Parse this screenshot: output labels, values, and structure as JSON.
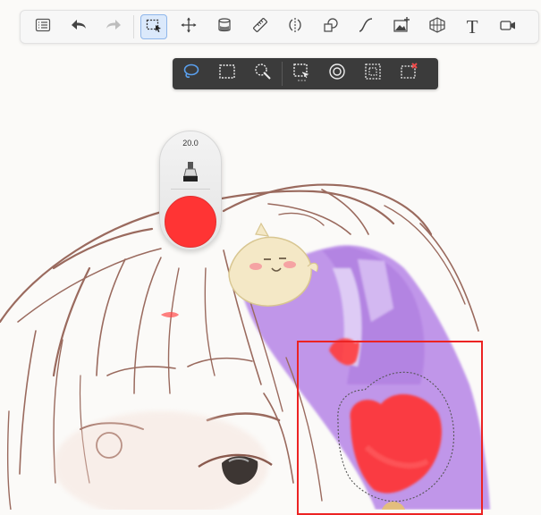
{
  "toolbar": {
    "tools": [
      {
        "name": "layers-list-button",
        "icon": "list-icon",
        "active": false
      },
      {
        "name": "undo-button",
        "icon": "undo-icon",
        "active": false
      },
      {
        "name": "redo-button",
        "icon": "redo-icon",
        "active": false
      },
      {
        "name": "selection-tool-button",
        "icon": "selection-icon",
        "active": true
      },
      {
        "name": "move-tool-button",
        "icon": "move-icon",
        "active": false
      },
      {
        "name": "fill-tool-button",
        "icon": "paint-bucket-icon",
        "active": false
      },
      {
        "name": "ruler-tool-button",
        "icon": "ruler-icon",
        "active": false
      },
      {
        "name": "symmetry-tool-button",
        "icon": "symmetry-icon",
        "active": false
      },
      {
        "name": "shape-tool-button",
        "icon": "shapes-icon",
        "active": false
      },
      {
        "name": "curve-tool-button",
        "icon": "curve-icon",
        "active": false
      },
      {
        "name": "image-insert-button",
        "icon": "image-plus-icon",
        "active": false
      },
      {
        "name": "perspective-grid-button",
        "icon": "perspective-grid-icon",
        "active": false
      },
      {
        "name": "text-tool-button",
        "icon": "text-icon",
        "active": false
      },
      {
        "name": "video-record-button",
        "icon": "video-camera-icon",
        "active": false
      }
    ],
    "text_tool_label": "T"
  },
  "selection_toolbar": {
    "tools": [
      {
        "name": "lasso-select-button",
        "icon": "lasso-icon",
        "active": true
      },
      {
        "name": "rectangle-select-button",
        "icon": "rect-marquee-icon"
      },
      {
        "name": "magic-wand-button",
        "icon": "magic-wand-icon"
      },
      {
        "name": "selection-options-button",
        "icon": "selection-options-icon"
      },
      {
        "name": "circle-select-button",
        "icon": "circle-target-icon"
      },
      {
        "name": "transform-selection-button",
        "icon": "transform-select-icon"
      },
      {
        "name": "clear-selection-button",
        "icon": "deselect-icon"
      }
    ]
  },
  "brush": {
    "size": "20.0",
    "color": "#ff3434",
    "tool_icon": "brush-nib-icon"
  },
  "colors": {
    "accent": "#2f7ad9",
    "selection_box": "#ec2323",
    "paint_red": "#ff3a3a",
    "paint_purple": "#a56ee0",
    "line_art": "#9a6a5e"
  }
}
